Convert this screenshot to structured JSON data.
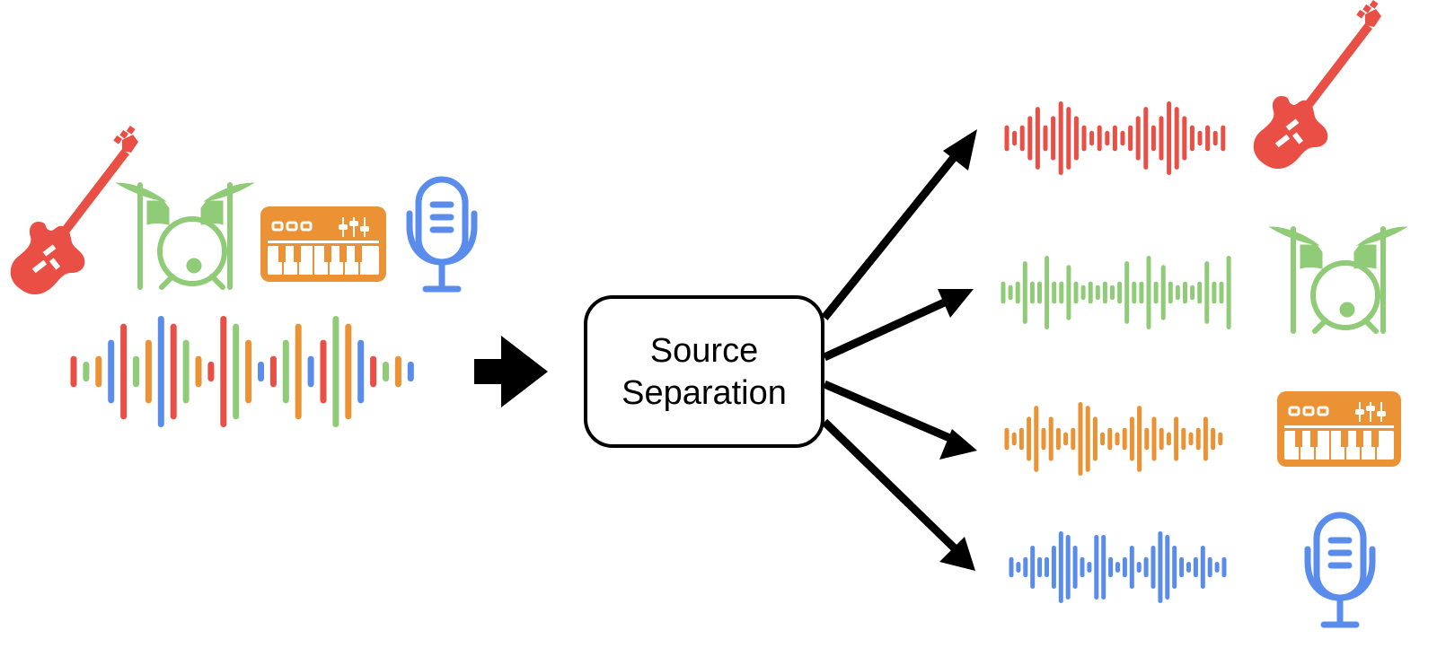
{
  "colors": {
    "guitar": "#ea4f45",
    "drums": "#90cb78",
    "keyboard": "#eb9234",
    "vocals": "#5a8cec",
    "ink": "#000000",
    "background": "#ffffff"
  },
  "process_box": {
    "line1": "Source",
    "line2": "Separation"
  },
  "input": {
    "instruments": [
      "electric-guitar",
      "drum-kit",
      "synth-keyboard",
      "microphone"
    ],
    "mixture_waveform": {
      "amplitudes": [
        0.28,
        0.18,
        0.28,
        0.57,
        0.86,
        0.28,
        0.57,
        1.0,
        0.86,
        0.57,
        0.28,
        0.18,
        1.0,
        0.86,
        0.57,
        0.18,
        0.28,
        0.57,
        0.86,
        0.28,
        0.57,
        1.0,
        0.86,
        0.57,
        0.28,
        0.18,
        0.28,
        0.18
      ],
      "colors": [
        "guitar",
        "drums",
        "keyboard",
        "vocals",
        "guitar",
        "drums",
        "keyboard",
        "vocals",
        "guitar",
        "drums",
        "keyboard",
        "guitar",
        "guitar",
        "drums",
        "keyboard",
        "vocals",
        "guitar",
        "drums",
        "keyboard",
        "vocals",
        "guitar",
        "drums",
        "keyboard",
        "vocals",
        "guitar",
        "drums",
        "keyboard",
        "vocals"
      ]
    }
  },
  "outputs": [
    {
      "name": "guitar",
      "color": "guitar",
      "icon": "electric-guitar",
      "amplitudes": [
        0.35,
        0.2,
        0.35,
        0.6,
        0.85,
        0.35,
        0.6,
        1.0,
        0.85,
        0.6,
        0.35,
        0.2,
        0.35,
        0.2,
        0.35,
        0.2,
        0.35,
        0.6,
        0.85,
        0.35,
        0.6,
        1.0,
        0.85,
        0.6,
        0.35,
        0.2,
        0.35,
        0.2,
        0.35
      ]
    },
    {
      "name": "drums",
      "color": "drums",
      "icon": "drum-kit",
      "amplitudes": [
        0.3,
        0.2,
        0.3,
        0.85,
        0.3,
        0.3,
        1.0,
        0.3,
        0.3,
        0.75,
        0.3,
        0.2,
        0.3,
        0.2,
        0.3,
        0.2,
        0.3,
        0.85,
        0.3,
        0.3,
        1.0,
        0.3,
        0.75,
        0.3,
        0.2,
        0.3,
        0.2,
        0.3,
        0.85,
        0.3,
        0.3,
        1.0
      ]
    },
    {
      "name": "keyboard",
      "color": "keyboard",
      "icon": "synth-keyboard",
      "amplitudes": [
        0.3,
        0.18,
        0.3,
        0.6,
        0.9,
        0.3,
        0.6,
        0.3,
        0.18,
        0.3,
        1.0,
        0.9,
        0.6,
        0.18,
        0.3,
        0.18,
        0.3,
        0.6,
        0.9,
        0.3,
        0.6,
        0.3,
        0.18,
        0.6,
        0.3,
        0.18,
        0.3,
        0.6,
        0.3,
        0.18
      ]
    },
    {
      "name": "vocals",
      "color": "vocals",
      "icon": "microphone",
      "amplitudes": [
        0.28,
        0.15,
        0.28,
        0.6,
        0.28,
        0.28,
        0.6,
        1.0,
        0.9,
        0.6,
        0.28,
        0.15,
        0.9,
        0.9,
        0.28,
        0.15,
        0.28,
        0.6,
        0.15,
        0.28,
        0.6,
        1.0,
        0.9,
        0.6,
        0.28,
        0.15,
        0.28,
        0.6,
        0.28,
        0.15,
        0.28
      ]
    }
  ]
}
